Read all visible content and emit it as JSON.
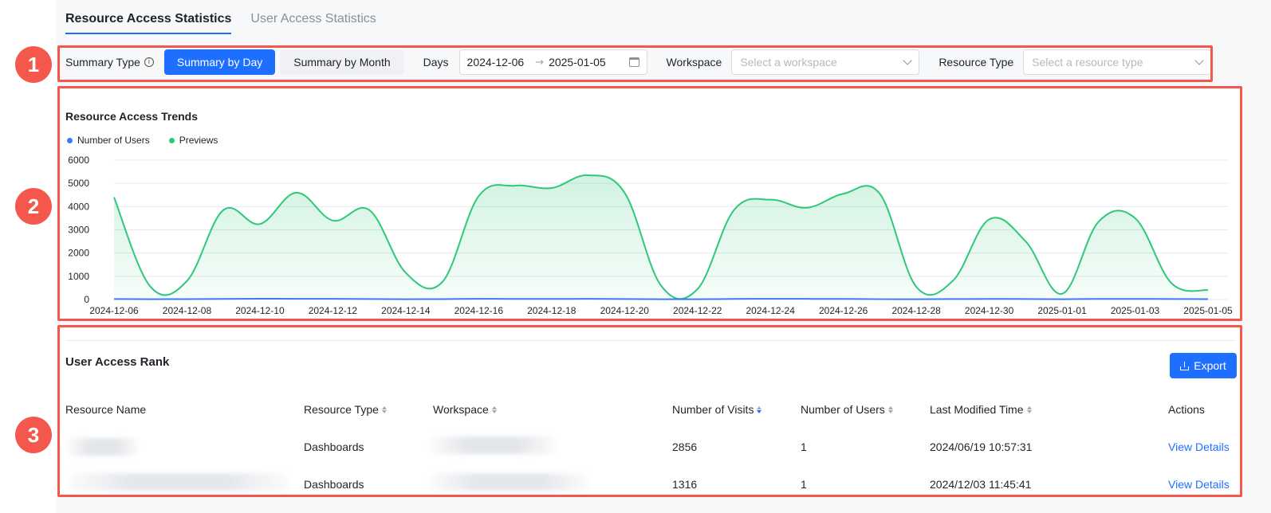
{
  "tabs": [
    {
      "label": "Resource Access Statistics",
      "active": true
    },
    {
      "label": "User Access Statistics",
      "active": false
    }
  ],
  "filters": {
    "summary_type_label": "Summary Type",
    "summary_by_day": "Summary by Day",
    "summary_by_month": "Summary by Month",
    "days_label": "Days",
    "date_start": "2024-12-06",
    "date_end": "2025-01-05",
    "workspace_label": "Workspace",
    "workspace_placeholder": "Select a workspace",
    "resource_type_label": "Resource Type",
    "resource_type_placeholder": "Select a resource type"
  },
  "annotations": [
    "1",
    "2",
    "3"
  ],
  "trend": {
    "title": "Resource Access Trends",
    "legend": [
      {
        "name": "Number of Users",
        "color": "#3b7cf6"
      },
      {
        "name": "Previews",
        "color": "#2fc878"
      }
    ]
  },
  "chart_data": {
    "type": "area",
    "title": "Resource Access Trends",
    "ylim": [
      0,
      6000
    ],
    "y_ticks": [
      "6000",
      "5000",
      "4000",
      "3000",
      "2000",
      "1000",
      "0"
    ],
    "x_tick_labels": [
      "2024-12-06",
      "2024-12-08",
      "2024-12-10",
      "2024-12-12",
      "2024-12-14",
      "2024-12-16",
      "2024-12-18",
      "2024-12-20",
      "2024-12-22",
      "2024-12-24",
      "2024-12-26",
      "2024-12-28",
      "2024-12-30",
      "2025-01-01",
      "2025-01-03",
      "2025-01-05"
    ],
    "x": [
      "2024-12-06",
      "2024-12-07",
      "2024-12-08",
      "2024-12-09",
      "2024-12-10",
      "2024-12-11",
      "2024-12-12",
      "2024-12-13",
      "2024-12-14",
      "2024-12-15",
      "2024-12-16",
      "2024-12-17",
      "2024-12-18",
      "2024-12-19",
      "2024-12-20",
      "2024-12-21",
      "2024-12-22",
      "2024-12-23",
      "2024-12-24",
      "2024-12-25",
      "2024-12-26",
      "2024-12-27",
      "2024-12-28",
      "2024-12-29",
      "2024-12-30",
      "2024-12-31",
      "2025-01-01",
      "2025-01-02",
      "2025-01-03",
      "2025-01-04",
      "2025-01-05"
    ],
    "grid": true,
    "legend_position": "top-left",
    "series": [
      {
        "name": "Number of Users",
        "color": "#3b7cf6",
        "values": [
          20,
          15,
          18,
          25,
          35,
          30,
          28,
          20,
          15,
          18,
          30,
          25,
          25,
          28,
          20,
          15,
          12,
          25,
          30,
          28,
          25,
          15,
          15,
          20,
          25,
          22,
          15,
          25,
          25,
          22,
          18
        ]
      },
      {
        "name": "Previews",
        "color": "#2fc878",
        "values": [
          4400,
          550,
          800,
          3850,
          3250,
          4600,
          3400,
          3850,
          1150,
          750,
          4450,
          4900,
          4800,
          5350,
          4600,
          600,
          450,
          3850,
          4300,
          3950,
          4550,
          4550,
          550,
          800,
          3450,
          2500,
          250,
          3350,
          3500,
          700,
          400
        ]
      }
    ]
  },
  "rank": {
    "title": "User Access Rank",
    "export_label": "Export",
    "columns": [
      "Resource Name",
      "Resource Type",
      "Workspace",
      "Number of Visits",
      "Number of Users",
      "Last Modified Time",
      "Actions"
    ],
    "rows": [
      {
        "type": "Dashboards",
        "visits": "2856",
        "users": "1",
        "modified": "2024/06/19 10:57:31",
        "action": "View Details"
      },
      {
        "type": "Dashboards",
        "visits": "1316",
        "users": "1",
        "modified": "2024/12/03 11:45:41",
        "action": "View Details"
      }
    ]
  }
}
